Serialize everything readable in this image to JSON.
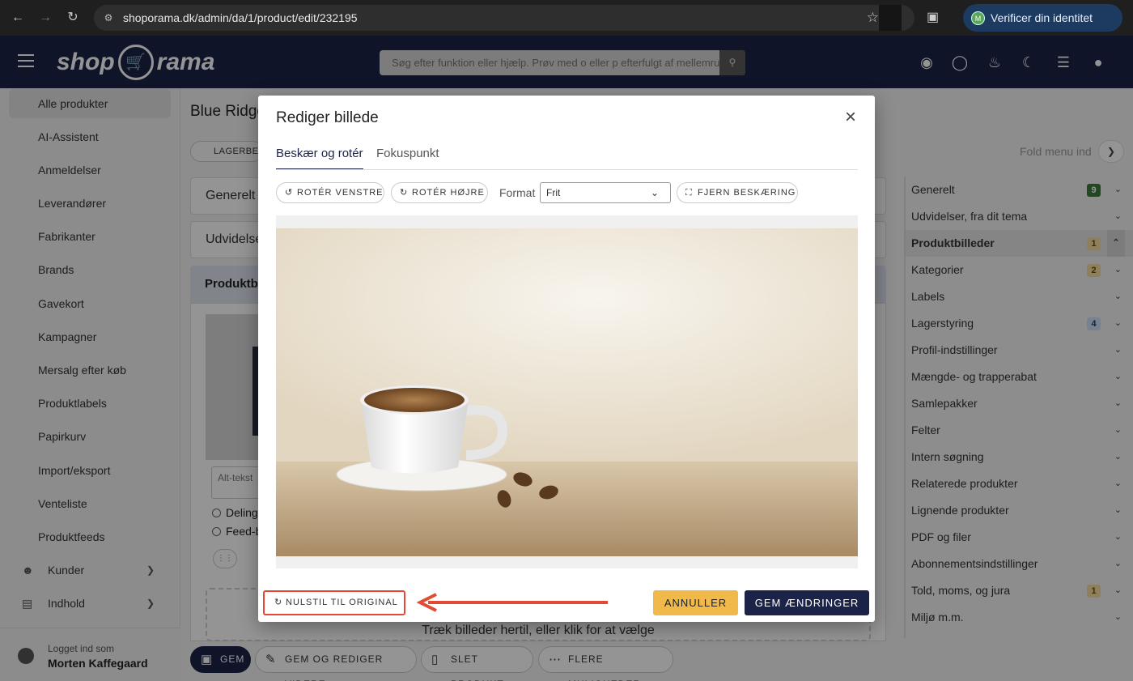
{
  "browser": {
    "url": "shoporama.dk/admin/da/1/product/edit/232195",
    "verify_label": "Verificer din identitet",
    "verify_avatar": "M"
  },
  "header": {
    "logo_left": "shop",
    "logo_right": "rama",
    "search_placeholder": "Søg efter funktion eller hjælp. Prøv med o eller p efterfulgt af mellemrum"
  },
  "sidebar": {
    "items": [
      {
        "label": "Alle produkter",
        "active": true
      },
      {
        "label": "AI-Assistent"
      },
      {
        "label": "Anmeldelser"
      },
      {
        "label": "Leverandører"
      },
      {
        "label": "Fabrikanter"
      },
      {
        "label": "Brands"
      },
      {
        "label": "Gavekort"
      },
      {
        "label": "Kampagner"
      },
      {
        "label": "Mersalg efter køb"
      },
      {
        "label": "Produktlabels"
      },
      {
        "label": "Papirkurv"
      },
      {
        "label": "Import/eksport"
      },
      {
        "label": "Venteliste"
      },
      {
        "label": "Produktfeeds"
      }
    ],
    "groups": [
      {
        "label": "Kunder"
      },
      {
        "label": "Indhold"
      }
    ],
    "footer": {
      "logged_in_label": "Logget ind som",
      "user": "Morten Kaffegaard"
    }
  },
  "main": {
    "title": "Blue Ridge",
    "chip_label": "LAGERBEV",
    "panels": [
      "Generelt",
      "Udvidelse"
    ],
    "section_title": "Produktbi",
    "alt_placeholder": "Alt-tekst",
    "radio_1": "Delings",
    "radio_2": "Feed-b",
    "dropzone_text": "Træk billeder hertil, eller klik for at vælge"
  },
  "right_panel": {
    "fold_label": "Fold menu ind",
    "items": [
      {
        "label": "Generelt",
        "badge": "9",
        "badge_color": "#3b7a3b",
        "badge_text_color": "#ffffff"
      },
      {
        "label": "Udvidelser, fra dit tema"
      },
      {
        "label": "Produktbilleder",
        "badge": "1",
        "badge_color": "#f4dca0",
        "badge_text_color": "#6b4a00",
        "active": true
      },
      {
        "label": "Kategorier",
        "badge": "2",
        "badge_color": "#f4dca0",
        "badge_text_color": "#6b4a00"
      },
      {
        "label": "Labels"
      },
      {
        "label": "Lagerstyring",
        "badge": "4",
        "badge_color": "#cfe0f4",
        "badge_text_color": "#1e3c6b"
      },
      {
        "label": "Profil-indstillinger"
      },
      {
        "label": "Mængde- og trapperabat"
      },
      {
        "label": "Samlepakker"
      },
      {
        "label": "Felter"
      },
      {
        "label": "Intern søgning"
      },
      {
        "label": "Relaterede produkter"
      },
      {
        "label": "Lignende produkter"
      },
      {
        "label": "PDF og filer"
      },
      {
        "label": "Abonnementsindstillinger"
      },
      {
        "label": "Told, moms, og jura",
        "badge": "1",
        "badge_color": "#f4dca0",
        "badge_text_color": "#6b4a00"
      },
      {
        "label": "Miljø m.m."
      }
    ]
  },
  "bottom_bar": {
    "save": "GEM",
    "save_continue": "GEM OG REDIGER VIDERE",
    "delete": "SLET PRODUKT",
    "more": "FLERE MULIGHEDER"
  },
  "modal": {
    "title": "Rediger billede",
    "tabs": [
      "Beskær og rotér",
      "Fokuspunkt"
    ],
    "rotate_left": "ROTÉR VENSTRE",
    "rotate_right": "ROTÉR HØJRE",
    "format_label": "Format",
    "format_value": "Frit",
    "remove_crop": "FJERN BESKÆRING",
    "reset": "NULSTIL TIL ORIGINAL",
    "cancel": "ANNULLER",
    "save": "GEM ÆNDRINGER"
  },
  "colors": {
    "brand": "#1b2348",
    "cancel": "#f1b84a",
    "annotation": "#e34a33"
  }
}
